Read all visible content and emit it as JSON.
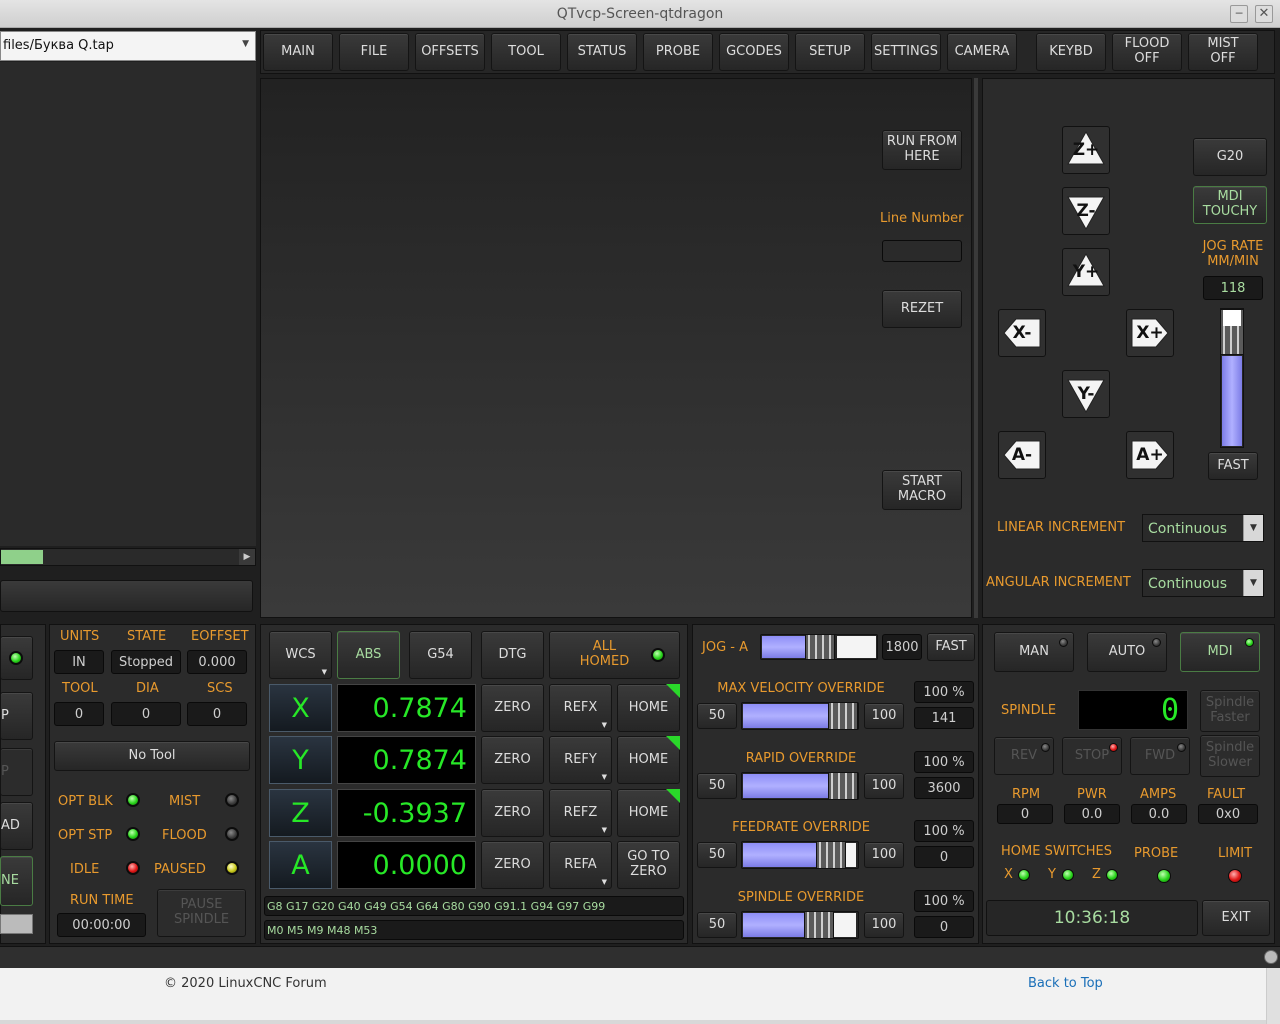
{
  "window": {
    "title": "QTvcp-Screen-qtdragon"
  },
  "file_combo": {
    "value": "files/Буква Q.tap"
  },
  "tabs": [
    "MAIN",
    "FILE",
    "OFFSETS",
    "TOOL",
    "STATUS",
    "PROBE",
    "GCODES",
    "SETUP",
    "SETTINGS",
    "CAMERA",
    "KEYBD"
  ],
  "flood": {
    "l1": "FLOOD",
    "l2": "OFF"
  },
  "mist": {
    "l1": "MIST",
    "l2": "OFF"
  },
  "center": {
    "run_from_l1": "RUN FROM",
    "run_from_l2": "HERE",
    "line_number_label": "Line Number",
    "rezet": "REZET",
    "start_macro_l1": "START",
    "start_macro_l2": "MACRO"
  },
  "jog_panel": {
    "buttons": {
      "z_plus": "Z+",
      "z_minus": "Z-",
      "y_plus": "Y+",
      "y_minus": "Y-",
      "x_minus": "X-",
      "x_plus": "X+",
      "a_minus": "A-",
      "a_plus": "A+"
    },
    "g20": "G20",
    "mdi_touchy_l1": "MDI",
    "mdi_touchy_l2": "TOUCHY",
    "jog_rate_l1": "JOG RATE",
    "jog_rate_l2": "MM/MIN",
    "jog_rate_value": "118",
    "jog_rate_level": 0.65,
    "fast": "FAST",
    "linear_increment_label": "LINEAR INCREMENT",
    "linear_increment_value": "Continuous",
    "angular_increment_label": "ANGULAR INCREMENT",
    "angular_increment_value": "Continuous"
  },
  "left_partial": {
    "b1": "P",
    "b2": "P",
    "b3": "AD",
    "b4": "NE"
  },
  "status": {
    "units_label": "UNITS",
    "state_label": "STATE",
    "eoffset_label": "EOFFSET",
    "units": "IN",
    "state": "Stopped",
    "eoffset": "0.000",
    "tool_label": "TOOL",
    "dia_label": "DIA",
    "scs_label": "SCS",
    "tool": "0",
    "dia": "0",
    "scs": "0",
    "tool_name": "No Tool",
    "opt_blk": "OPT BLK",
    "mist": "MIST",
    "opt_stp": "OPT STP",
    "flood": "FLOOD",
    "idle": "IDLE",
    "paused": "PAUSED",
    "run_time_label": "RUN TIME",
    "run_time": "00:00:00",
    "pause_spindle_l1": "PAUSE",
    "pause_spindle_l2": "SPINDLE"
  },
  "dro": {
    "wcs": "WCS",
    "abs": "ABS",
    "g54": "G54",
    "dtg": "DTG",
    "all_homed_l1": "ALL",
    "all_homed_l2": "HOMED",
    "axes": [
      {
        "letter": "X",
        "value": "0.7874",
        "zero": "ZERO",
        "ref": "REFX",
        "home": "HOME"
      },
      {
        "letter": "Y",
        "value": "0.7874",
        "zero": "ZERO",
        "ref": "REFY",
        "home": "HOME"
      },
      {
        "letter": "Z",
        "value": "-0.3937",
        "zero": "ZERO",
        "ref": "REFZ",
        "home": "HOME"
      },
      {
        "letter": "A",
        "value": "0.0000",
        "zero": "ZERO",
        "ref": "REFA",
        "goto_l1": "GO TO",
        "goto_l2": "ZERO"
      }
    ],
    "gcodes": "G8 G17 G20 G40 G49 G54 G64 G80 G90 G91.1 G94 G97 G99",
    "mcodes": "M0 M5 M9 M48 M53"
  },
  "overrides": {
    "jog_a_label": "JOG - A",
    "jog_a_value": "1800",
    "jog_a_fast": "FAST",
    "max_velocity": {
      "label": "MAX VELOCITY OVERRIDE",
      "min": "50",
      "max": "100",
      "pct": "100 %",
      "val": "141",
      "level": 1.0
    },
    "rapid": {
      "label": "RAPID OVERRIDE",
      "min": "50",
      "max": "100",
      "pct": "100 %",
      "val": "3600",
      "level": 1.0
    },
    "feedrate": {
      "label": "FEEDRATE OVERRIDE",
      "min": "50",
      "max": "100",
      "pct": "100 %",
      "val": "0",
      "level": 1.0
    },
    "spindle": {
      "label": "SPINDLE OVERRIDE",
      "min": "50",
      "max": "100",
      "pct": "100 %",
      "val": "0",
      "level": 1.0
    }
  },
  "spindle_panel": {
    "man": "MAN",
    "auto": "AUTO",
    "mdi": "MDI",
    "spindle_label": "SPINDLE",
    "spindle_lcd": "0",
    "faster_l1": "Spindle",
    "faster_l2": "Faster",
    "rev": "REV",
    "stop": "STOP",
    "fwd": "FWD",
    "slower_l1": "Spindle",
    "slower_l2": "Slower",
    "rpm_label": "RPM",
    "pwr_label": "PWR",
    "amps_label": "AMPS",
    "fault_label": "FAULT",
    "rpm": "0",
    "pwr": "0.0",
    "amps": "0.0",
    "fault": "0x0",
    "home_switches_label": "HOME SWITCHES",
    "probe_label": "PROBE",
    "limit_label": "LIMIT",
    "hx": "X",
    "hy": "Y",
    "hz": "Z",
    "clock": "10:36:18",
    "exit": "EXIT"
  },
  "footer": {
    "copyright": "© 2020 LinuxCNC Forum",
    "back_to_top": "Back to Top"
  },
  "colors": {
    "accent_orange": "#e89a2e",
    "dro_green": "#27e827",
    "link_blue": "#1a6fb8"
  }
}
